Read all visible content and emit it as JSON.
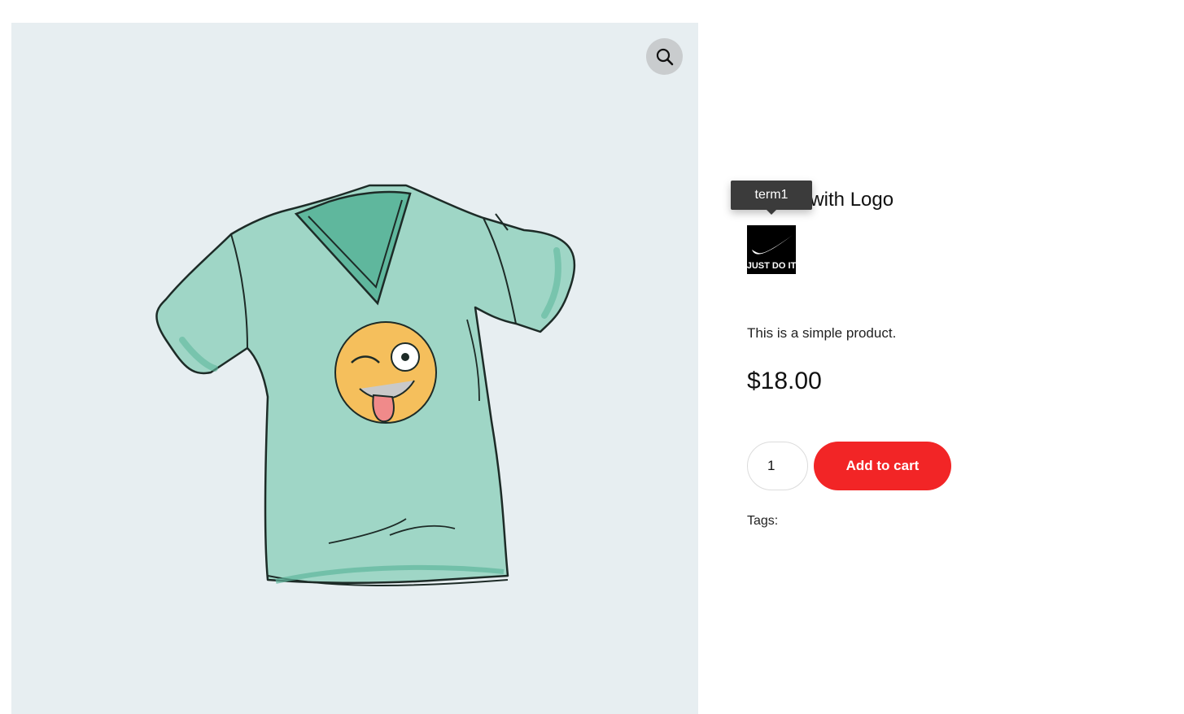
{
  "gallery": {
    "zoom_icon": "search-icon",
    "image_alt": "T-shirt with wink tongue emoji"
  },
  "product": {
    "title": "T-Shirt with Logo",
    "brand_tooltip": "term1",
    "brand_logo_text": "JUST DO IT",
    "description": "This is a simple product.",
    "price": "$18.00",
    "quantity": "1",
    "add_to_cart_label": "Add to cart",
    "tags_label": "Tags:"
  },
  "colors": {
    "accent": "#f22526",
    "gallery_bg": "#e7eef1",
    "shirt": "#9fd6c6"
  }
}
